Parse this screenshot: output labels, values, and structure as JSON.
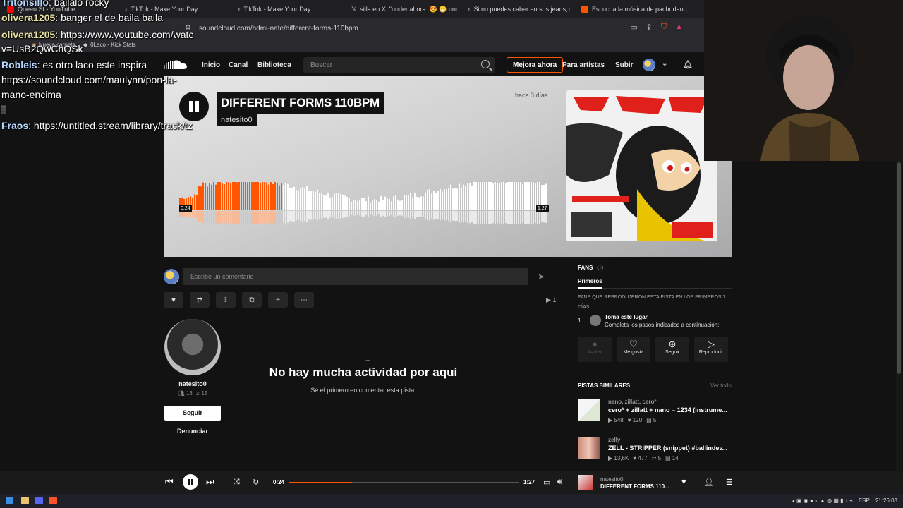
{
  "browser": {
    "tabs": [
      {
        "label": "Queen St - YouTube",
        "icon_color": "#ff0000"
      },
      {
        "label": "TikTok - Make Your Day",
        "icon_color": "#111111"
      },
      {
        "label": "TikTok - Make Your Day",
        "icon_color": "#111111"
      },
      {
        "label": "silla en X: \"under ahora: 😍 😁 unde...",
        "icon_color": "#111111"
      },
      {
        "label": "Si no puedes caber en sus jeans, no ...",
        "icon_color": "#111111"
      },
      {
        "label": "Escucha la música de pachudani | D...",
        "icon_color": "#ff5500"
      }
    ],
    "url": "soundcloud.com/hdmi-nate/different-forms-110bpm",
    "bookmarks": [
      "Nueva carpeta",
      "0Laco - Kick Stats"
    ]
  },
  "nav": {
    "links": [
      "Inicio",
      "Canal",
      "Biblioteca"
    ],
    "search_placeholder": "Buscar",
    "upgrade": "Mejora ahora",
    "for_artists": "Para artistas",
    "upload": "Subir"
  },
  "track": {
    "title": "DIFFERENT FORMS 110BPM",
    "artist": "natesito0",
    "posted": "hace 3 días",
    "elapsed": "0:24",
    "duration": "1:27",
    "progress": 0.276,
    "plays": "1"
  },
  "comment": {
    "placeholder": "Escribe un comentario"
  },
  "uploader": {
    "name": "natesito0",
    "followers": "13",
    "tracks": "15",
    "follow": "Seguir",
    "report": "Denunciar"
  },
  "empty_state": {
    "title": "No hay mucha actividad por aquí",
    "subtitle": "Sé el primero en comentar esta pista."
  },
  "fans": {
    "heading": "FANS",
    "tab": "Primeros",
    "description": "FANS QUE REPRODUJERON ESTA PISTA EN LOS PRIMEROS 7 DÍAS:",
    "rank": "1",
    "rank_title": "Toma este lugar",
    "rank_sub": "Completa los pasos indicados a continuación:",
    "steps": [
      "Avatar",
      "Me gusta",
      "Seguir",
      "Reproducir"
    ]
  },
  "similar": {
    "heading": "PISTAS SIMILARES",
    "see_all": "Ver todo",
    "items": [
      {
        "artist": "nano, zillatt, cero*",
        "title": "cero* + zillatt + nano = 1234 (instrume...",
        "plays": "548",
        "likes": "120",
        "comments": "5"
      },
      {
        "artist": "zelly",
        "title": "ZELL - STRIPPER (snippet) #ballindev...",
        "plays": "13,6K",
        "likes": "477",
        "reposts": "5",
        "comments": "14"
      }
    ]
  },
  "player": {
    "elapsed": "0:24",
    "duration": "1:27",
    "artist": "natesito0",
    "title": "DIFFERENT FORMS 110..."
  },
  "taskbar": {
    "lang": "ESP",
    "time": "21:26:03"
  },
  "chat": [
    {
      "user": "Tritonsillo",
      "text": "bailalo rocky"
    },
    {
      "user": "olivera1205",
      "text": "banger el de baila baila"
    },
    {
      "user": "olivera1205",
      "text": "https://www.youtube.com/watc"
    },
    {
      "user": "",
      "text": "v=UsB2QwChQSk"
    },
    {
      "user": "Robleis",
      "text": "es otro laco este inspira"
    },
    {
      "user": "",
      "text": "https://soundcloud.com/maulynn/pon-la-"
    },
    {
      "user": "",
      "text": "mano-encima"
    },
    {
      "user": "Fraos",
      "text": "https://untitled.stream/library/track/tz"
    }
  ],
  "colors": {
    "accent": "#ff5500",
    "chat_user": "#b8d8ff"
  }
}
